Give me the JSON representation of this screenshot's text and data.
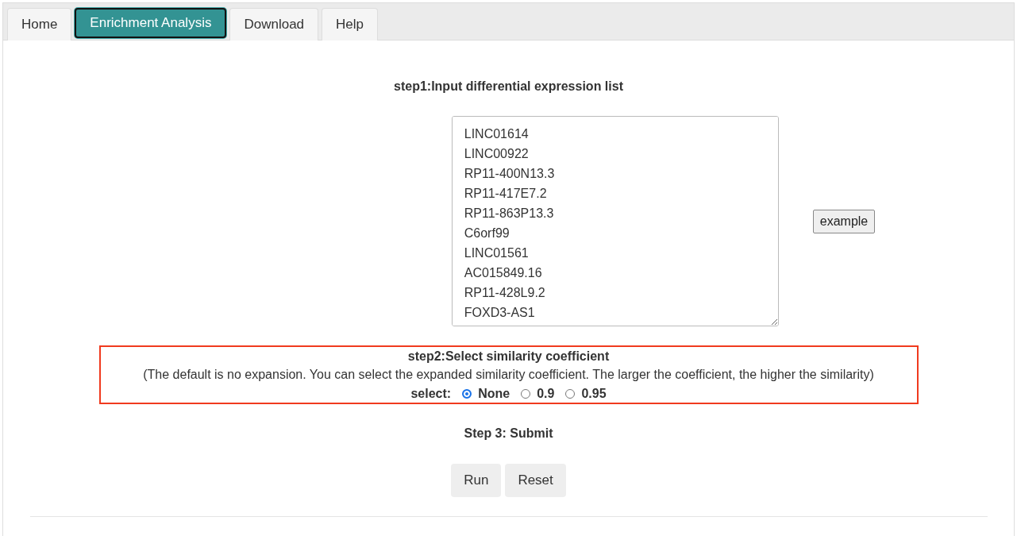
{
  "tabs": [
    {
      "label": "Home",
      "selected": false
    },
    {
      "label": "Enrichment Analysis",
      "selected": true
    },
    {
      "label": "Download",
      "selected": false
    },
    {
      "label": "Help",
      "selected": false
    }
  ],
  "step1": {
    "title": "step1:Input differential expression list",
    "input_lines": [
      "LINC01614",
      "LINC00922",
      "RP11-400N13.3",
      "RP11-417E7.2",
      "RP11-863P13.3",
      "C6orf99",
      "LINC01561",
      "AC015849.16",
      "RP11-428L9.2",
      "FOXD3-AS1"
    ],
    "example_button": "example"
  },
  "step2": {
    "title": "step2:Select similarity coefficient",
    "note": "(The default is no expansion. You can select the expanded similarity coefficient. The larger the coefficient, the higher the similarity)",
    "select_label": "select:",
    "options": [
      {
        "label": "None",
        "selected": true
      },
      {
        "label": "0.9",
        "selected": false
      },
      {
        "label": "0.95",
        "selected": false
      }
    ]
  },
  "step3": {
    "title": "Step 3: Submit",
    "buttons": [
      "Run",
      "Reset"
    ]
  }
}
